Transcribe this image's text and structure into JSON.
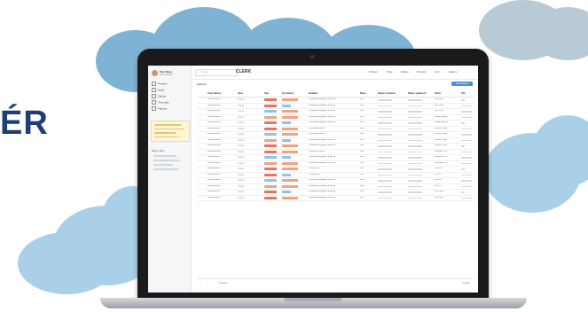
{
  "headline": "ÉR",
  "app": {
    "user_name": "Petr Novy",
    "user_role": "Administrator",
    "brand": "CLERK",
    "search_placeholder": "Hledat",
    "nav": [
      "Prehled",
      "Mzdy",
      "Zaloha",
      "Prevodky",
      "Faktura"
    ],
    "subnav_title": "Moje volby",
    "top_menu": [
      "Prehled",
      "Mzdy",
      "Zaloha",
      "Prevody",
      "Kurz",
      "Faktury"
    ],
    "section_title": "Faktura",
    "add_button": "Nova faktura",
    "columns": [
      "Cislo faktury",
      "Akce",
      "Stav",
      "Typ faktury",
      "Dodatek",
      "Mena",
      "Datum vystaveni",
      "Datum splatnosti",
      "Klient",
      "ICO"
    ],
    "rows": [
      {
        "id": "2019/0000001",
        "desc": "Pravidelne poplatky za sluzby",
        "currency": "CZK",
        "client": "Petr Novy"
      },
      {
        "id": "2019/0000002",
        "desc": "Pravidelne poplatky za sluzby",
        "currency": "CZK",
        "client": "Petr Novy"
      },
      {
        "id": "2019/0000003",
        "desc": "Pravidelne poplatky za sluzby",
        "currency": "CZK",
        "client": "Petr Novy"
      },
      {
        "id": "2019/0000004",
        "desc": "Pravidelne poplatky za sluzby",
        "currency": "CZK",
        "client": "Global Agency"
      },
      {
        "id": "2019/0000005",
        "desc": "Pravidelne poplatky za sluzby",
        "currency": "CZK",
        "client": "Global Agency"
      },
      {
        "id": "2019/0000006",
        "desc": "Vyuctovani sluzeb",
        "currency": "CZK",
        "client": "Jindrich Pena"
      },
      {
        "id": "2019/0000007",
        "desc": "Vyuctovani sluzeb",
        "currency": "CZK",
        "client": "Jindrich Pena"
      },
      {
        "id": "2019/0000008",
        "desc": "Pravidelne poplatky za sluzby",
        "currency": "CZK",
        "client": "Jindrich Pena"
      },
      {
        "id": "2019/0000009",
        "desc": "Pravidelne poplatky za sluzby",
        "currency": "CZK",
        "client": "Jindrich Pena"
      },
      {
        "id": "2019/0000010",
        "desc": "Vyuctovani sluzeb",
        "currency": "CZK",
        "client": "Software s.r.o."
      },
      {
        "id": "2019/0000011",
        "desc": "Pravidelne poplatky za sluzby",
        "currency": "CZK",
        "client": "Software s.r.o."
      },
      {
        "id": "2019/0000012",
        "desc": "Pravidelne poplatky za sluzby",
        "currency": "CZK",
        "client": "Software s.r.o."
      },
      {
        "id": "2019/0000013",
        "desc": "Prodej zbozi",
        "currency": "CZK",
        "client": "eD s.r.o."
      },
      {
        "id": "2019/0000014",
        "desc": "Prodej zbozi",
        "currency": "CZK",
        "client": "eD s.r.o."
      },
      {
        "id": "2019/0000015",
        "desc": "Pravidelne poplatky za sluzby",
        "currency": "CZK",
        "client": "eD s.r.o."
      },
      {
        "id": "2019/0000016",
        "desc": "Pravidelne poplatky za sluzby",
        "currency": "CZK",
        "client": "eD s.r.o."
      },
      {
        "id": "2019/0000017",
        "desc": "Pravidelne poplatky za sluzby",
        "currency": "CZK",
        "client": "Petr Novy"
      },
      {
        "id": "2019/0000018",
        "desc": "Pravidelne poplatky za sluzby",
        "currency": "CZK",
        "client": "Petr Novy"
      }
    ],
    "pagination_label": "1 stranka",
    "total_label": "Celkem"
  },
  "colors": {
    "heading": "#1d3f72",
    "accent": "#4a90d9",
    "status_red": "#e8745e",
    "status_blue": "#8fc3e8",
    "status_orange": "#f3a27a"
  }
}
